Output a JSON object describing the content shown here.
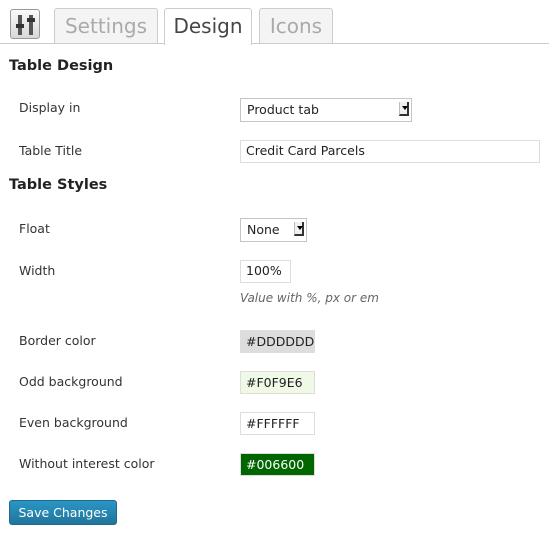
{
  "tabs": [
    {
      "label": "Settings",
      "active": false
    },
    {
      "label": "Design",
      "active": true
    },
    {
      "label": "Icons",
      "active": false
    }
  ],
  "sections": {
    "table_design": {
      "heading": "Table Design",
      "display_in": {
        "label": "Display in",
        "value": "Product tab"
      },
      "table_title": {
        "label": "Table Title",
        "value": "Credit Card Parcels"
      }
    },
    "table_styles": {
      "heading": "Table Styles",
      "float": {
        "label": "Float",
        "value": "None"
      },
      "width": {
        "label": "Width",
        "value": "100%",
        "hint": "Value with %, px or em"
      },
      "border_color": {
        "label": "Border color",
        "value": "#DDDDDD",
        "color": "#dddddd",
        "text_color": "#222222"
      },
      "odd_background": {
        "label": "Odd background",
        "value": "#F0F9E6",
        "color": "#f0f9e6",
        "text_color": "#222222"
      },
      "even_background": {
        "label": "Even background",
        "value": "#FFFFFF",
        "color": "#ffffff",
        "text_color": "#222222"
      },
      "without_interest_color": {
        "label": "Without interest color",
        "value": "#006600",
        "color": "#006600",
        "text_color": "#ffffff"
      }
    }
  },
  "save_button": {
    "label": "Save Changes"
  },
  "icons": {
    "app_icon": "sliders-icon",
    "select_arrow": "chevron-down-icon"
  },
  "colors": {
    "accent": "#21759b",
    "tab_border": "#cccccc"
  }
}
